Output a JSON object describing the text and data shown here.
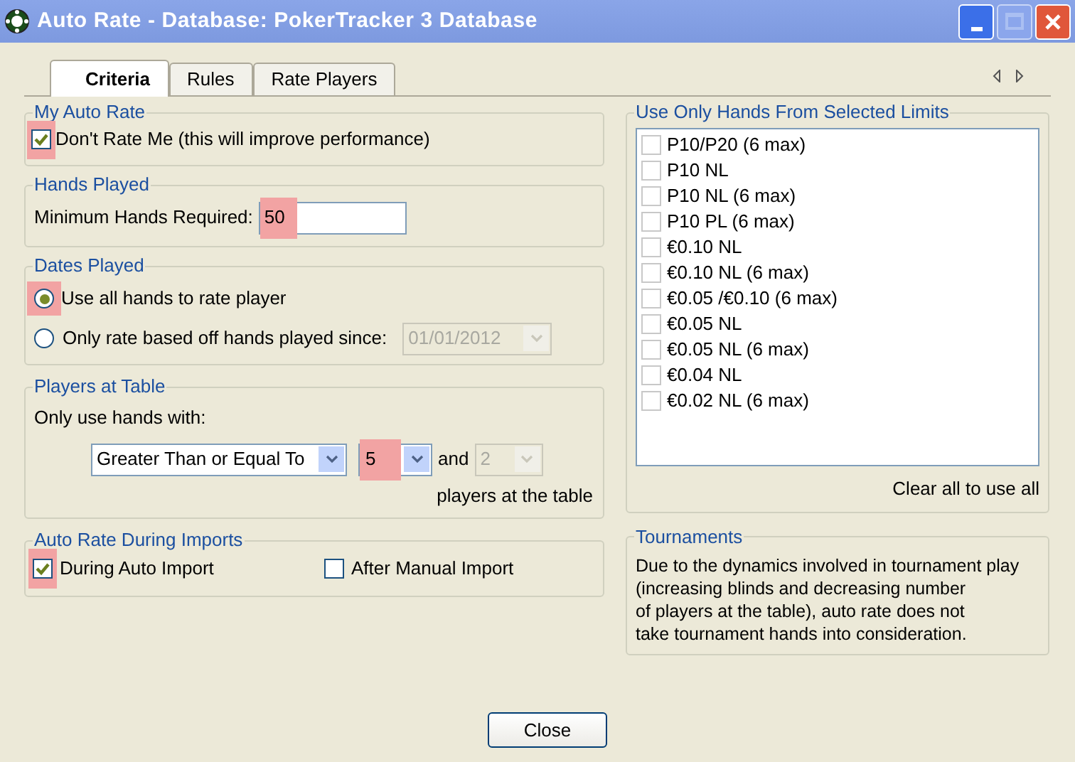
{
  "window": {
    "title": "Auto Rate - Database: PokerTracker 3 Database"
  },
  "tabs": [
    {
      "label": "Criteria",
      "selected": true
    },
    {
      "label": "Rules",
      "selected": false
    },
    {
      "label": "Rate Players",
      "selected": false
    }
  ],
  "my_auto_rate": {
    "title": "My Auto Rate",
    "checkbox": {
      "label": "Don't Rate Me (this will improve performance)",
      "checked": true,
      "highlighted": true
    }
  },
  "hands_played": {
    "title": "Hands Played",
    "field": {
      "label": "Minimum Hands Required:",
      "value": "50",
      "highlighted": true
    }
  },
  "dates_played": {
    "title": "Dates Played",
    "options": [
      {
        "label": "Use all hands to rate player",
        "selected": true,
        "highlighted": true
      },
      {
        "label": "Only rate based off hands played since:",
        "selected": false,
        "highlighted": false
      }
    ],
    "date": {
      "value": "01/01/2012",
      "disabled": true
    }
  },
  "players_at_table": {
    "title": "Players at Table",
    "label": "Only use hands with:",
    "comparison": {
      "value": "Greater Than or Equal To"
    },
    "count": {
      "value": "5",
      "highlighted": true
    },
    "joiner": "and",
    "count_2": {
      "value": "2",
      "disabled": true
    },
    "suffix": "players at the table"
  },
  "imports": {
    "title": "Auto Rate During Imports",
    "checkboxes": [
      {
        "label": "During Auto Import",
        "checked": true,
        "highlighted": true
      },
      {
        "label": "After Manual Import",
        "checked": false,
        "highlighted": false
      }
    ]
  },
  "limits": {
    "title": "Use Only Hands From Selected Limits",
    "items": [
      {
        "label": "P10/P20 (6 max)",
        "checked": false
      },
      {
        "label": "P10 NL",
        "checked": false
      },
      {
        "label": "P10 NL (6 max)",
        "checked": false
      },
      {
        "label": "P10 PL (6 max)",
        "checked": false
      },
      {
        "label": "€0.10 NL",
        "checked": false
      },
      {
        "label": "€0.10 NL (6 max)",
        "checked": false
      },
      {
        "label": "€0.05 /€0.10 (6 max)",
        "checked": false
      },
      {
        "label": "€0.05 NL",
        "checked": false
      },
      {
        "label": "€0.05 NL (6 max)",
        "checked": false
      },
      {
        "label": "€0.04 NL",
        "checked": false
      },
      {
        "label": "€0.02 NL (6 max)",
        "checked": false
      }
    ],
    "hint": "Clear all to use all"
  },
  "tournaments": {
    "title": "Tournaments",
    "lines": [
      "Due to the dynamics involved in tournament play",
      "(increasing blinds and decreasing number",
      "of players at the table), auto rate does not",
      "take tournament hands into consideration."
    ]
  },
  "close_button": "Close"
}
